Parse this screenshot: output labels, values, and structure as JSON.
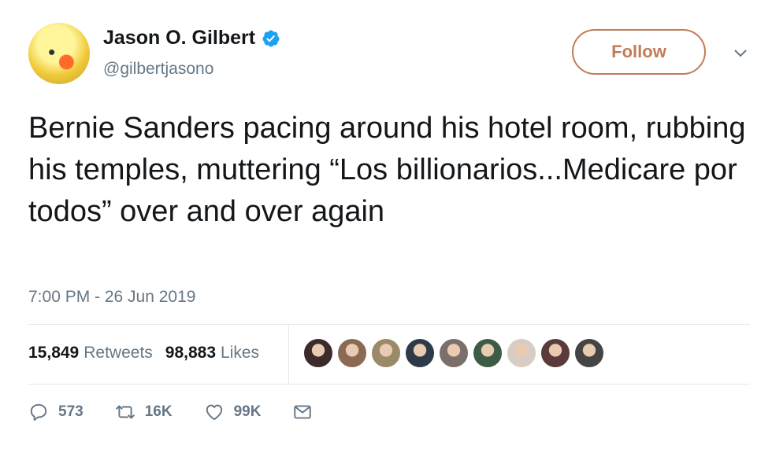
{
  "user": {
    "name": "Jason O. Gilbert",
    "handle": "@gilbertjasono",
    "verified": true
  },
  "follow_label": "Follow",
  "tweet": {
    "text": "Bernie Sanders pacing around his hotel room, rubbing his temples, muttering “Los billionarios...Medicare por todos” over and over again",
    "timestamp": "7:00 PM - 26 Jun 2019"
  },
  "stats": {
    "retweets": "15,849",
    "retweets_label": "Retweets",
    "likes": "98,883",
    "likes_label": "Likes"
  },
  "liker_avatars": [
    {
      "color": "#3d2a2a"
    },
    {
      "color": "#8a6a55"
    },
    {
      "color": "#9a8a6a"
    },
    {
      "color": "#2f3a48"
    },
    {
      "color": "#7a6f6a"
    },
    {
      "color": "#3c5c46"
    },
    {
      "color": "#d8cdc4"
    },
    {
      "color": "#5a3a3a"
    },
    {
      "color": "#444444"
    }
  ],
  "actions": {
    "replies": "573",
    "retweets": "16K",
    "likes": "99K"
  },
  "colors": {
    "follow_accent": "#c17b57",
    "verified": "#1da1f2",
    "secondary_text": "#657786"
  }
}
